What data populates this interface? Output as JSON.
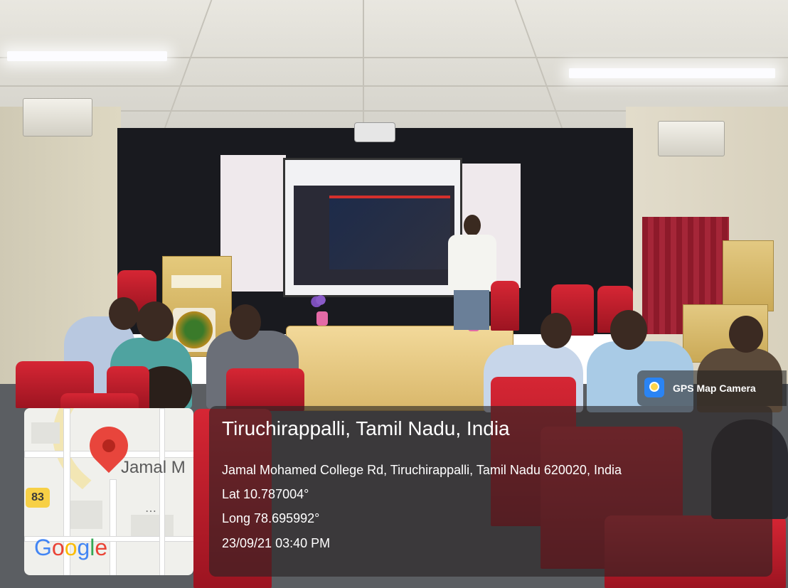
{
  "overlay": {
    "app_badge": {
      "label": "GPS Map Camera",
      "icon": "gps-camera-icon"
    },
    "location": {
      "title": "Tiruchirappalli, Tamil Nadu, India",
      "address": "Jamal Mohamed College Rd, Tiruchirappalli, Tamil Nadu 620020, India",
      "lat": "Lat 10.787004°",
      "long": "Long 78.695992°",
      "timestamp": "23/09/21 03:40 PM"
    },
    "map": {
      "place_label": "Jamal M",
      "route_number": "83",
      "brand": [
        "G",
        "o",
        "o",
        "g",
        "l",
        "e"
      ],
      "pin_icon": "map-pin-icon"
    }
  }
}
